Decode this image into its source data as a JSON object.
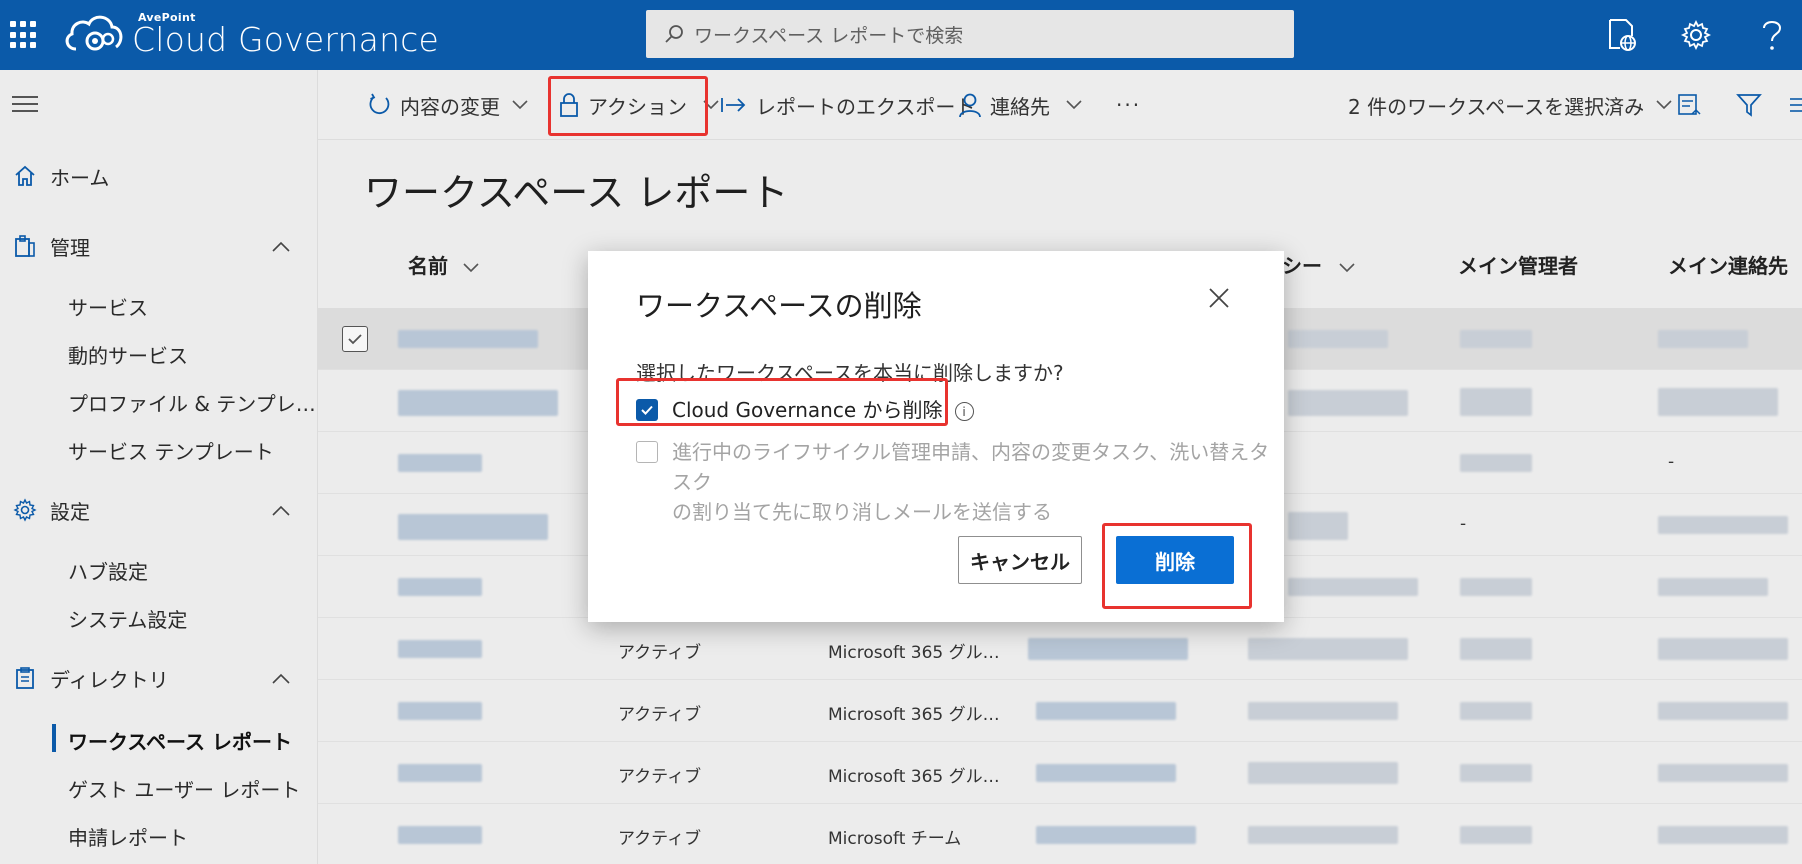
{
  "app": {
    "brand_small": "AvePoint",
    "brand_name": "Cloud Governance"
  },
  "search": {
    "placeholder": "ワークスペース レポートで検索"
  },
  "sidebar": {
    "items": [
      {
        "label": "ホーム",
        "icon": "home-icon"
      },
      {
        "label": "管理",
        "icon": "clipboard-icon",
        "expanded": true,
        "children": [
          "サービス",
          "動的サービス",
          "プロファイル & テンプレ…",
          "サービス テンプレート"
        ]
      },
      {
        "label": "設定",
        "icon": "gear-icon",
        "expanded": true,
        "children": [
          "ハブ設定",
          "システム設定"
        ]
      },
      {
        "label": "ディレクトリ",
        "icon": "directory-icon",
        "expanded": true,
        "children": [
          "ワークスペース レポート",
          "ゲスト ユーザー レポート",
          "申請レポート"
        ],
        "active_child": "ワークスペース レポート"
      }
    ]
  },
  "toolbar": {
    "change_content": "内容の変更",
    "action": "アクション",
    "export": "レポートのエクスポート",
    "contact": "連絡先",
    "more": "···",
    "selected": "2 件のワークスペースを選択済み"
  },
  "page": {
    "title": "ワークスペース レポート"
  },
  "columns": {
    "name": "名前",
    "policy_partial": "シー",
    "primary_admin": "メイン管理者",
    "primary_contact": "メイン連絡先"
  },
  "rows": [
    {
      "status": "",
      "type": "",
      "admin": "",
      "contact": ""
    },
    {
      "status": "",
      "type": "",
      "admin": "",
      "contact": ""
    },
    {
      "status": "",
      "type": "",
      "admin": "",
      "contact": "-"
    },
    {
      "status": "",
      "type": "",
      "admin": "-",
      "contact": ""
    },
    {
      "status": "",
      "type": "",
      "admin": "",
      "contact": ""
    },
    {
      "status": "アクティブ",
      "type": "Microsoft 365 グル…",
      "admin": "",
      "contact": ""
    },
    {
      "status": "アクティブ",
      "type": "Microsoft 365 グル…",
      "admin": "",
      "contact": ""
    },
    {
      "status": "アクティブ",
      "type": "Microsoft 365 グル…",
      "admin": "",
      "contact": ""
    },
    {
      "status": "アクティブ",
      "type": "Microsoft チーム",
      "admin": "",
      "contact": ""
    }
  ],
  "dialog": {
    "title": "ワークスペースの削除",
    "question": "選択したワークスペースを本当に削除しますか?",
    "option1": "Cloud Governance から削除",
    "option1_checked": true,
    "option2": "進行中のライフサイクル管理申請、内容の変更タスク、洗い替えタスクの割り当て先に取り消しメールを送信する",
    "option2_line1": "進行中のライフサイクル管理申請、内容の変更タスク、洗い替えタスク",
    "option2_line2": "の割り当て先に取り消しメールを送信する",
    "option2_checked": false,
    "cancel": "キャンセル",
    "delete": "削除"
  },
  "colors": {
    "brand": "#0b5aa9",
    "primary_button": "#0a6fd4",
    "highlight": "#e8332f"
  }
}
